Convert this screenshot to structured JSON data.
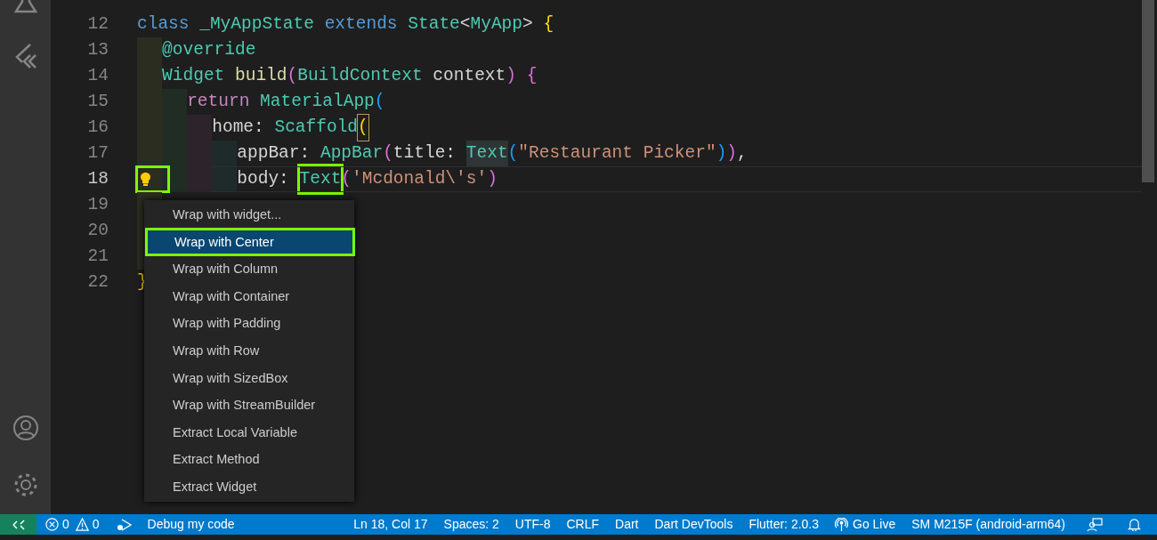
{
  "editor": {
    "lines": [
      {
        "number": "12",
        "tokens": [
          {
            "text": "class ",
            "kind": "keyword"
          },
          {
            "text": "_MyAppState ",
            "kind": "type"
          },
          {
            "text": "extends ",
            "kind": "keyword"
          },
          {
            "text": "State",
            "kind": "type"
          },
          {
            "text": "<",
            "kind": "plain"
          },
          {
            "text": "MyApp",
            "kind": "type"
          },
          {
            "text": "> ",
            "kind": "plain"
          },
          {
            "text": "{",
            "kind": "bracket1"
          }
        ]
      },
      {
        "number": "13",
        "guides": [
          {
            "color": "#2c2d21"
          }
        ],
        "tokens": [
          {
            "text": "@override",
            "kind": "type"
          }
        ]
      },
      {
        "number": "14",
        "guides": [
          {
            "color": "#2c2d21"
          }
        ],
        "tokens": [
          {
            "text": "Widget ",
            "kind": "type"
          },
          {
            "text": "build",
            "kind": "function"
          },
          {
            "text": "(",
            "kind": "bracket2"
          },
          {
            "text": "BuildContext ",
            "kind": "type"
          },
          {
            "text": "context",
            "kind": "plain"
          },
          {
            "text": ") ",
            "kind": "bracket2"
          },
          {
            "text": "{",
            "kind": "bracket2"
          }
        ]
      },
      {
        "number": "15",
        "guides": [
          {
            "color": "#2c2d21"
          },
          {
            "color": "#212c25"
          }
        ],
        "tokens": [
          {
            "text": "return ",
            "kind": "control"
          },
          {
            "text": "MaterialApp",
            "kind": "type"
          },
          {
            "text": "(",
            "kind": "bracket3"
          }
        ]
      },
      {
        "number": "16",
        "guides": [
          {
            "color": "#2c2d21"
          },
          {
            "color": "#212c25"
          },
          {
            "color": "#2d242b"
          }
        ],
        "tokens": [
          {
            "text": "home: ",
            "kind": "plain"
          },
          {
            "text": "Scaffold",
            "kind": "type"
          },
          {
            "text": "(",
            "kind": "bracket1",
            "matched": true
          }
        ]
      },
      {
        "number": "17",
        "guides": [
          {
            "color": "#2c2d21"
          },
          {
            "color": "#212c25"
          },
          {
            "color": "#2d242b"
          },
          {
            "color": "#1f2b2b"
          }
        ],
        "tokens": [
          {
            "text": "appBar: ",
            "kind": "plain"
          },
          {
            "text": "AppBar",
            "kind": "type"
          },
          {
            "text": "(",
            "kind": "bracket2"
          },
          {
            "text": "title: ",
            "kind": "plain"
          },
          {
            "text": "Text",
            "kind": "type",
            "occurrence": true
          },
          {
            "text": "(",
            "kind": "bracket3"
          },
          {
            "text": "\"Restaurant Picker\"",
            "kind": "string"
          },
          {
            "text": ")",
            "kind": "bracket3"
          },
          {
            "text": ")",
            "kind": "bracket2"
          },
          {
            "text": ",",
            "kind": "plain"
          }
        ]
      },
      {
        "number": "18",
        "current": true,
        "lightbulb": true,
        "guides": [
          {
            "color": "#2c2d21"
          },
          {
            "color": "#212c25"
          },
          {
            "color": "#2d242b"
          },
          {
            "color": "#1f2b2b"
          }
        ],
        "tokens": [
          {
            "text": "body: ",
            "kind": "plain"
          },
          {
            "text": "Text",
            "kind": "type",
            "outlined": true
          },
          {
            "text": "(",
            "kind": "bracket2"
          },
          {
            "text": "'Mcdonald\\'s'",
            "kind": "string"
          },
          {
            "text": ")",
            "kind": "bracket2"
          }
        ]
      },
      {
        "number": "19",
        "guides": [
          {
            "color": "#2c2d21"
          }
        ]
      },
      {
        "number": "20",
        "guides": [
          {
            "color": "#2c2d21"
          }
        ]
      },
      {
        "number": "21",
        "guides": [
          {
            "color": "#2c2d21"
          }
        ]
      },
      {
        "number": "22",
        "tokens": [
          {
            "text": "}",
            "kind": "bracket1"
          }
        ]
      }
    ]
  },
  "code_actions_menu": {
    "items": [
      {
        "label": "Wrap with widget...",
        "selected": false
      },
      {
        "label": "Wrap with Center",
        "selected": true,
        "outlined": true
      },
      {
        "label": "Wrap with Column",
        "selected": false
      },
      {
        "label": "Wrap with Container",
        "selected": false
      },
      {
        "label": "Wrap with Padding",
        "selected": false
      },
      {
        "label": "Wrap with Row",
        "selected": false
      },
      {
        "label": "Wrap with SizedBox",
        "selected": false
      },
      {
        "label": "Wrap with StreamBuilder",
        "selected": false
      },
      {
        "label": "Extract Local Variable",
        "selected": false
      },
      {
        "label": "Extract Method",
        "selected": false
      },
      {
        "label": "Extract Widget",
        "selected": false
      }
    ]
  },
  "status_bar": {
    "errors": "0",
    "warnings": "0",
    "debug_label": "Debug my code",
    "right_items": [
      {
        "label": "Ln 18, Col 17",
        "kind": "text"
      },
      {
        "label": "Spaces: 2",
        "kind": "text"
      },
      {
        "label": "UTF-8",
        "kind": "text"
      },
      {
        "label": "CRLF",
        "kind": "text"
      },
      {
        "label": "Dart",
        "kind": "text"
      },
      {
        "label": "Dart DevTools",
        "kind": "text"
      },
      {
        "label": "Flutter: 2.0.3",
        "kind": "text"
      },
      {
        "label": "Go Live",
        "kind": "live"
      },
      {
        "label": "SM M215F (android-arm64)",
        "kind": "text"
      }
    ]
  }
}
